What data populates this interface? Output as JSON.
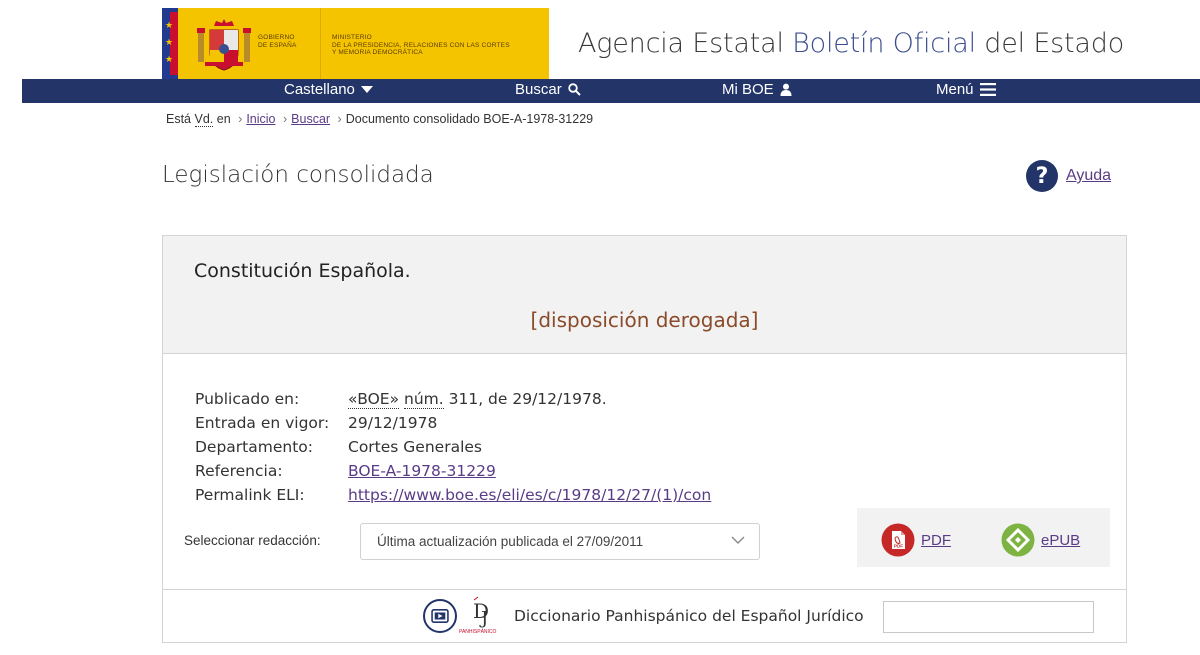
{
  "header": {
    "gov_line1": "GOBIERNO",
    "gov_line2": "DE ESPAÑA",
    "ministry_line1": "MINISTERIO",
    "ministry_line2": "DE LA PRESIDENCIA, RELACIONES CON LAS CORTES",
    "ministry_line3": "Y MEMORIA DEMOCRÁTICA",
    "agency_part1": "Agencia Estatal ",
    "agency_part2": "Boletín Oficial",
    "agency_part3": " del Estado"
  },
  "nav": {
    "language": "Castellano",
    "search": "Buscar",
    "my_boe": "Mi BOE",
    "menu": "Menú"
  },
  "breadcrumb": {
    "prefix_1": "Está",
    "prefix_vd": "Vd.",
    "prefix_2": "en",
    "home": "Inicio",
    "search": "Buscar",
    "current": "Documento consolidado BOE-A-1978-31229"
  },
  "page": {
    "title": "Legislación consolidada",
    "help": "Ayuda"
  },
  "document": {
    "title": "Constitución Española.",
    "status": "[disposición derogada]",
    "published_label": "Publicado en:",
    "published_boe": "«BOE»",
    "published_num_abbr": "núm.",
    "published_rest": " 311, de 29/12/1978.",
    "in_force_label": "Entrada en vigor:",
    "in_force_value": "29/12/1978",
    "department_label": "Departamento:",
    "department_value": "Cortes Generales",
    "reference_label": "Referencia:",
    "reference_value": "BOE-A-1978-31229",
    "eli_label": "Permalink ELI:",
    "eli_value": "https://www.boe.es/eli/es/c/1978/12/27/(1)/con"
  },
  "version_select": {
    "label": "Seleccionar redacción:",
    "selected": "Última actualización publicada el 27/09/2011"
  },
  "downloads": {
    "pdf": "PDF",
    "pdf_badge": "PDF",
    "epub": "ePUB"
  },
  "dictionary": {
    "logo_text": "PANHISPÁNICO",
    "label": "Diccionario Panhispánico del Español Jurídico",
    "input_value": ""
  },
  "colors": {
    "navy": "#233469",
    "gold": "#f5c400",
    "link": "#5a3b86",
    "derogada": "#8a4b2a",
    "pdf_red": "#c62828",
    "epub_green": "#7cb342"
  }
}
